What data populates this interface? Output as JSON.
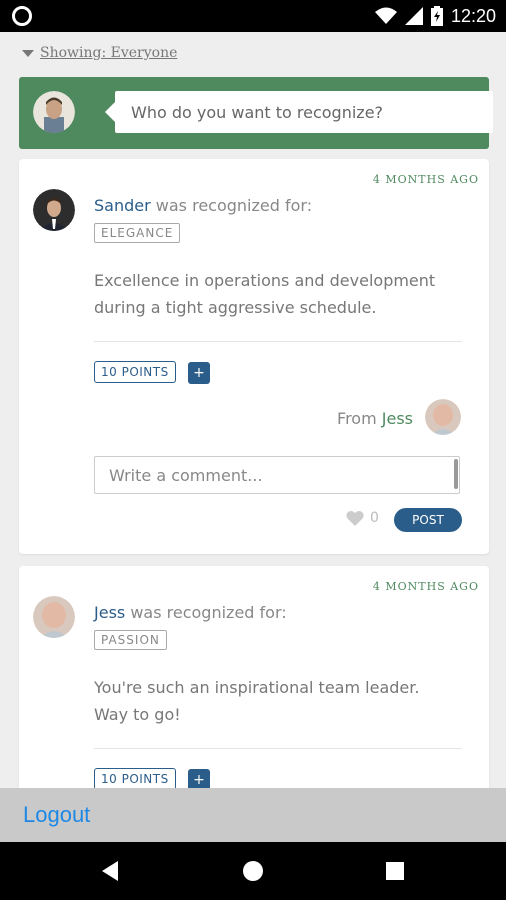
{
  "status_bar": {
    "time": "12:20"
  },
  "filter": {
    "label": "Showing: Everyone"
  },
  "recognize": {
    "placeholder": "Who do you want to recognize?"
  },
  "cards": [
    {
      "timestamp": "4 MONTHS AGO",
      "name": "Sander",
      "recognized_text": "was recognized for:",
      "tag": "ELEGANCE",
      "message": "Excellence in operations and development during a tight aggressive schedule.",
      "points": "10 POINTS",
      "plus": "+",
      "from_prefix": "From",
      "from_name": "Jess",
      "comment_placeholder": "Write a comment...",
      "likes": "0",
      "post_label": "POST"
    },
    {
      "timestamp": "4 MONTHS AGO",
      "name": "Jess",
      "recognized_text": "was recognized for:",
      "tag": "PASSION",
      "message": "You're such an inspirational team leader. Way to go!",
      "points": "10 POINTS",
      "plus": "+"
    }
  ],
  "footer": {
    "logout": "Logout"
  },
  "colors": {
    "accent_green": "#4f8a5f",
    "accent_blue": "#2b5d8a",
    "link_blue": "#1e88e5"
  }
}
